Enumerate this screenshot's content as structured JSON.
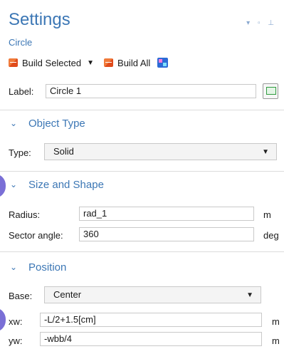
{
  "header": {
    "title": "Settings",
    "subtitle": "Circle",
    "window_controls": "▾ ▫ ⊥"
  },
  "toolbar": {
    "build_selected": "Build Selected",
    "build_all": "Build All"
  },
  "label_row": {
    "label": "Label:",
    "value": "Circle 1"
  },
  "sections": {
    "object_type": "Object Type",
    "size_and_shape": "Size and Shape",
    "position": "Position"
  },
  "object_type": {
    "label": "Type:",
    "value": "Solid"
  },
  "size_and_shape": {
    "radius": {
      "label": "Radius:",
      "value": "rad_1",
      "unit": "m"
    },
    "sector_angle": {
      "label": "Sector angle:",
      "value": "360",
      "unit": "deg"
    }
  },
  "position": {
    "base": {
      "label": "Base:",
      "value": "Center"
    },
    "xw": {
      "label": "xw:",
      "value": "-L/2+1.5[cm]",
      "unit": "m"
    },
    "yw": {
      "label": "yw:",
      "value": "-wbb/4",
      "unit": "m"
    }
  },
  "icons": {
    "chevron": "⌄",
    "dropdown_arrow": "▼"
  }
}
